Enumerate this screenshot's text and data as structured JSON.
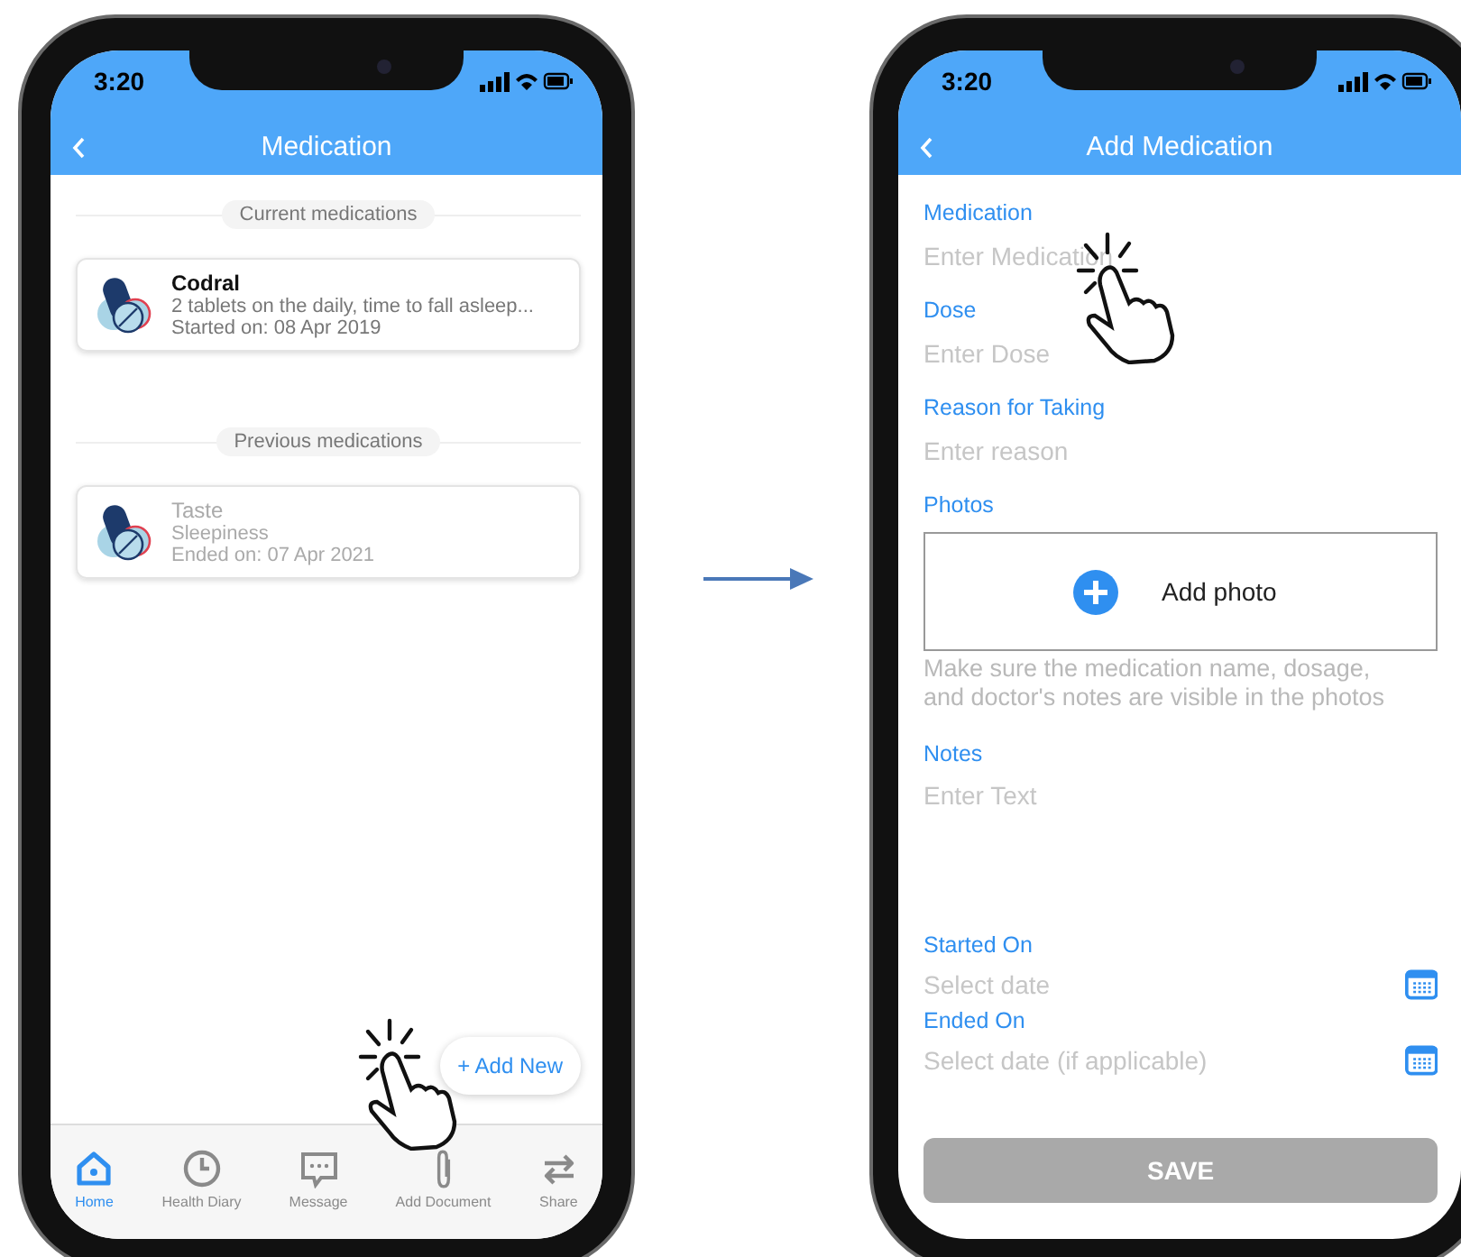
{
  "list_screen": {
    "status_bar": {
      "time": "3:20"
    },
    "header": {
      "title": "Medication"
    },
    "sections": [
      {
        "label": "Current medications",
        "cards": [
          {
            "name": "Codral",
            "detail": "2 tablets on the daily, time to fall asleep...",
            "date": "Started on: 08 Apr 2019",
            "inactive": false
          }
        ]
      },
      {
        "label": "Previous medications",
        "cards": [
          {
            "name": "Taste",
            "detail": "Sleepiness",
            "date": "Ended on: 07 Apr 2021",
            "inactive": true
          }
        ]
      }
    ],
    "add_button": {
      "label": "+ Add New"
    },
    "tab_bar": [
      {
        "label": "Home",
        "selected": true
      },
      {
        "label": "Health Diary",
        "selected": false
      },
      {
        "label": "Message",
        "selected": false
      },
      {
        "label": "Add Document",
        "selected": false
      },
      {
        "label": "Share",
        "selected": false
      }
    ]
  },
  "form_screen": {
    "status_bar": {
      "time": "3:20"
    },
    "header": {
      "title": "Add Medication"
    },
    "fields": [
      {
        "kind": "text",
        "label": "Medication",
        "placeholder": "Enter Medication"
      },
      {
        "kind": "text",
        "label": "Dose",
        "placeholder": "Enter Dose"
      },
      {
        "kind": "text",
        "label": "Reason for Taking",
        "placeholder": "Enter reason"
      },
      {
        "kind": "photos",
        "label": "Photos",
        "button": "Add photo",
        "hint": "Make sure the medication name, dosage, and doctor's notes are visible in the photos"
      },
      {
        "kind": "textarea",
        "label": "Notes",
        "placeholder": "Enter Text"
      },
      {
        "kind": "date",
        "label": "Started On",
        "placeholder": "Select date"
      },
      {
        "kind": "date",
        "label": "Ended On",
        "placeholder": "Select date (if applicable)"
      }
    ],
    "save_button": {
      "label": "SAVE",
      "disabled": true
    }
  }
}
